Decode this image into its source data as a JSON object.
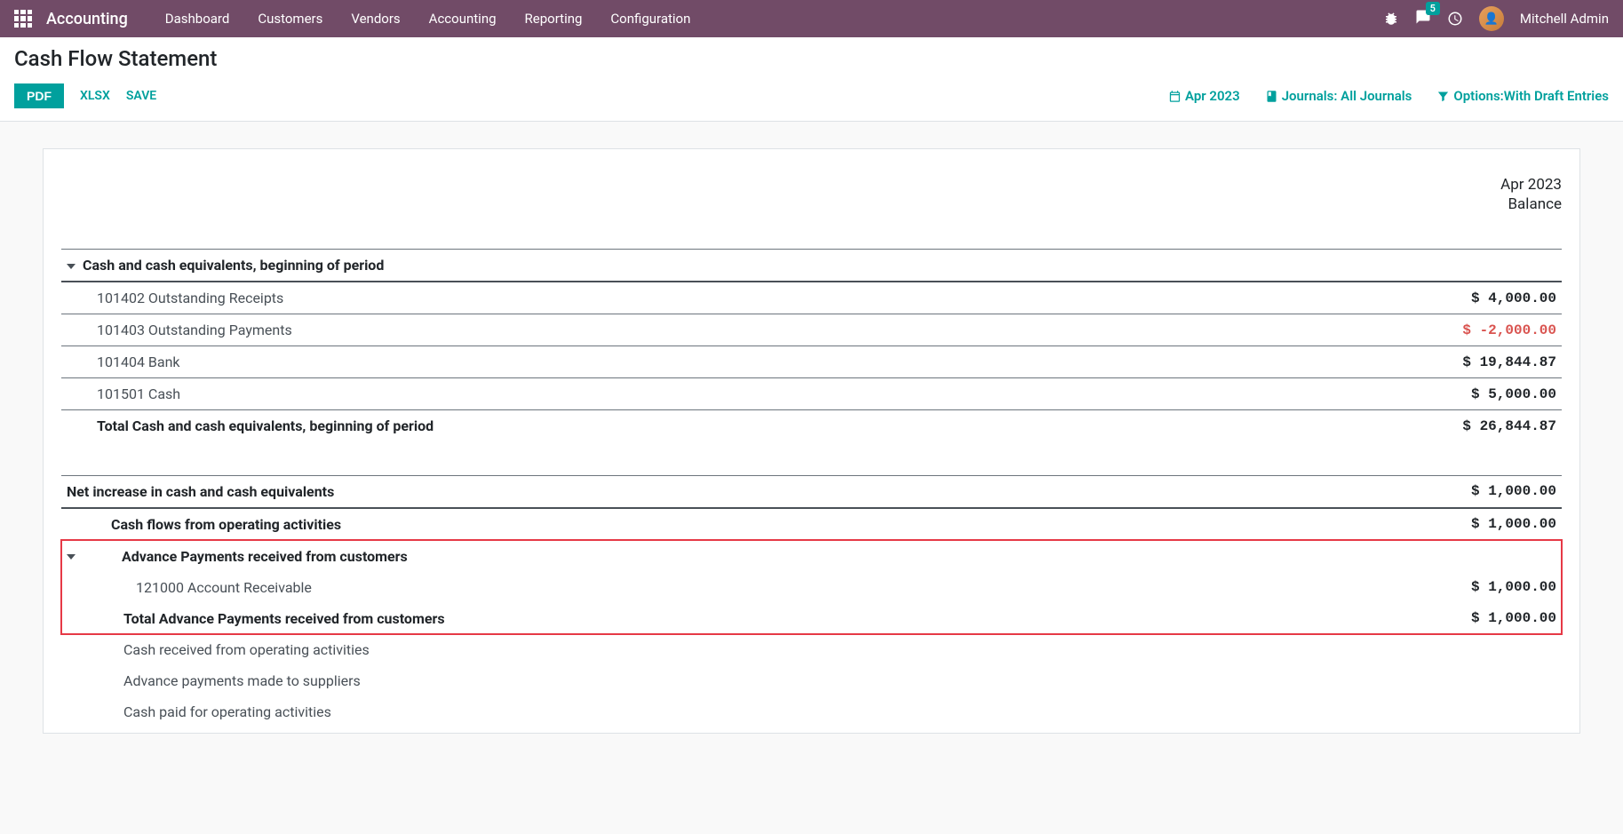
{
  "nav": {
    "brand": "Accounting",
    "items": [
      "Dashboard",
      "Customers",
      "Vendors",
      "Accounting",
      "Reporting",
      "Configuration"
    ],
    "msg_count": "5",
    "user": "Mitchell Admin"
  },
  "page": {
    "title": "Cash Flow Statement",
    "actions": {
      "pdf": "PDF",
      "xlsx": "XLSX",
      "save": "SAVE"
    },
    "filters": {
      "date": "Apr 2023",
      "journals": "Journals: All Journals",
      "options": "Options:With Draft Entries"
    }
  },
  "report": {
    "period": "Apr 2023",
    "balance_label": "Balance",
    "r1_label": "Cash and cash equivalents, beginning of period",
    "r1a_label": "101402 Outstanding Receipts",
    "r1a_val": "$ 4,000.00",
    "r1b_label": "101403 Outstanding Payments",
    "r1b_val": "$ -2,000.00",
    "r1c_label": "101404 Bank",
    "r1c_val": "$ 19,844.87",
    "r1d_label": "101501 Cash",
    "r1d_val": "$ 5,000.00",
    "r1t_label": "Total Cash and cash equivalents, beginning of period",
    "r1t_val": "$ 26,844.87",
    "r2_label": "Net increase in cash and cash equivalents",
    "r2_val": "$ 1,000.00",
    "r2a_label": "Cash flows from operating activities",
    "r2a_val": "$ 1,000.00",
    "r2b_label": "Advance Payments received from customers",
    "r2b1_label": "121000 Account Receivable",
    "r2b1_val": "$ 1,000.00",
    "r2bt_label": "Total Advance Payments received from customers",
    "r2bt_val": "$ 1,000.00",
    "r2c_label": "Cash received from operating activities",
    "r2d_label": "Advance payments made to suppliers",
    "r2e_label": "Cash paid for operating activities"
  }
}
